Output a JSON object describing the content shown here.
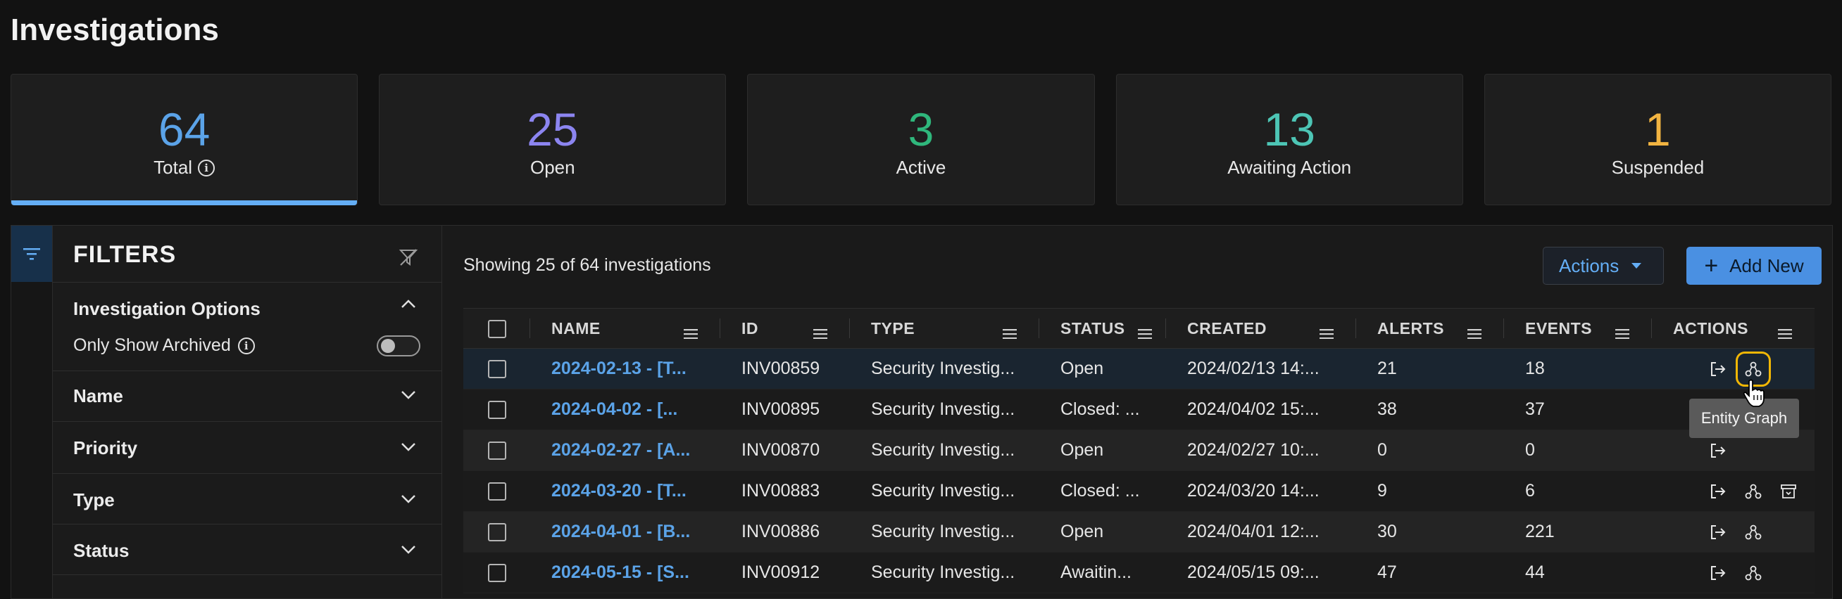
{
  "page": {
    "title": "Investigations"
  },
  "stats": [
    {
      "value": "64",
      "label": "Total",
      "color": "#5ba3e8",
      "info": true
    },
    {
      "value": "25",
      "label": "Open",
      "color": "#8c85f0"
    },
    {
      "value": "3",
      "label": "Active",
      "color": "#2fb77c"
    },
    {
      "value": "13",
      "label": "Awaiting Action",
      "color": "#4dc5b5"
    },
    {
      "value": "1",
      "label": "Suspended",
      "color": "#f2b441"
    }
  ],
  "filters": {
    "title": "FILTERS",
    "investigation_options": "Investigation Options",
    "only_archived": "Only Show Archived",
    "sections": [
      "Name",
      "Priority",
      "Type",
      "Status"
    ]
  },
  "toolbar": {
    "showing": "Showing 25 of 64 investigations",
    "actions_label": "Actions",
    "add_label": "Add New"
  },
  "table": {
    "columns": [
      "NAME",
      "ID",
      "TYPE",
      "STATUS",
      "CREATED",
      "ALERTS",
      "EVENTS",
      "ACTIONS"
    ],
    "rows": [
      {
        "name": "2024-02-13 - [T...",
        "id": "INV00859",
        "type": "Security Investig...",
        "status": "Open",
        "created": "2024/02/13 14:...",
        "alerts": "21",
        "events": "18"
      },
      {
        "name": "2024-04-02 - [...",
        "id": "INV00895",
        "type": "Security Investig...",
        "status": "Closed: ...",
        "created": "2024/04/02 15:...",
        "alerts": "38",
        "events": "37"
      },
      {
        "name": "2024-02-27 - [A...",
        "id": "INV00870",
        "type": "Security Investig...",
        "status": "Open",
        "created": "2024/02/27 10:...",
        "alerts": "0",
        "events": "0"
      },
      {
        "name": "2024-03-20 - [T...",
        "id": "INV00883",
        "type": "Security Investig...",
        "status": "Closed: ...",
        "created": "2024/03/20 14:...",
        "alerts": "9",
        "events": "6"
      },
      {
        "name": "2024-04-01 - [B...",
        "id": "INV00886",
        "type": "Security Investig...",
        "status": "Open",
        "created": "2024/04/01 12:...",
        "alerts": "30",
        "events": "221"
      },
      {
        "name": "2024-05-15 - [S...",
        "id": "INV00912",
        "type": "Security Investig...",
        "status": "Awaitin...",
        "created": "2024/05/15 09:...",
        "alerts": "47",
        "events": "44"
      }
    ]
  },
  "tooltip": {
    "text": "Entity Graph"
  }
}
